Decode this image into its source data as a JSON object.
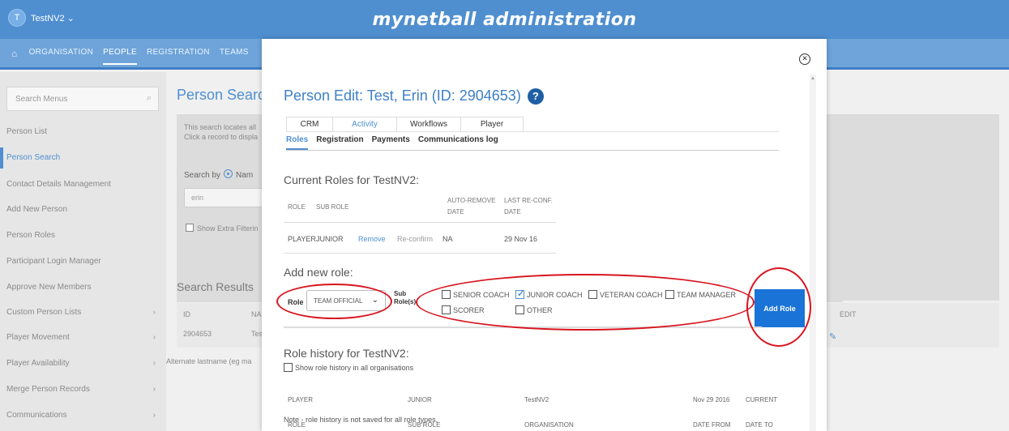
{
  "header": {
    "user_initial": "T",
    "user_name": "TestNV2 ⌄",
    "app_title": "mynetball administration"
  },
  "nav": {
    "home_icon": "home-icon",
    "items": [
      "ORGANISATION",
      "PEOPLE",
      "REGISTRATION",
      "TEAMS"
    ]
  },
  "sidebar": {
    "search_placeholder": "Search Menus",
    "items": [
      {
        "label": "Person List",
        "chevron": false
      },
      {
        "label": "Person Search",
        "chevron": false,
        "active": true
      },
      {
        "label": "Contact Details Management",
        "chevron": false
      },
      {
        "label": "Add New Person",
        "chevron": false
      },
      {
        "label": "Person Roles",
        "chevron": false
      },
      {
        "label": "Participant Login Manager",
        "chevron": false
      },
      {
        "label": "Approve New Members",
        "chevron": false
      },
      {
        "label": "Custom Person Lists",
        "chevron": true
      },
      {
        "label": "Player Movement",
        "chevron": true
      },
      {
        "label": "Player Availability",
        "chevron": true
      },
      {
        "label": "Merge Person Records",
        "chevron": true
      },
      {
        "label": "Communications",
        "chevron": true
      }
    ]
  },
  "background": {
    "title": "Person Search",
    "desc_line1": "This search locates all",
    "desc_line2": "Click a record to displa",
    "search_by": "Search by",
    "search_by_option": "Nam",
    "search_value": "erin",
    "extra_filter": "Show Extra Filterin",
    "results_title": "Search Results",
    "col_id": "ID",
    "col_name": "NAI",
    "col_edit": "EDIT",
    "row_id": "2904653",
    "row_name": "Test",
    "alt_note": "Alternate lastname (eg ma"
  },
  "modal": {
    "title": "Person Edit: Test, Erin (ID: 2904653)",
    "tabs_top": [
      "CRM",
      "Activity",
      "Workflows",
      "Player"
    ],
    "tabs_top_active": "Activity",
    "tabs_sub": [
      "Roles",
      "Registration",
      "Payments",
      "Communications log"
    ],
    "tabs_sub_active": "Roles",
    "current_roles_title": "Current Roles for TestNV2:",
    "current_roles": {
      "headers": {
        "role": "ROLE",
        "sub_role": "SUB ROLE",
        "auto_remove_1": "AUTO-REMOVE",
        "auto_remove_2": "DATE",
        "last_reconf_1": "LAST RE-CONF.",
        "last_reconf_2": "DATE"
      },
      "row": {
        "role": "PLAYER",
        "sub_role": "JUNIOR",
        "remove": "Remove",
        "reconfirm": "Re-confirm",
        "auto_remove": "NA",
        "last_reconf": "29 Nov 16"
      }
    },
    "add_role_title": "Add new role:",
    "role_label": "Role",
    "role_value": "TEAM OFFICIAL",
    "sub_role_label": "Sub Role(s)",
    "sub_roles": [
      {
        "label": "SENIOR COACH",
        "checked": false
      },
      {
        "label": "JUNIOR COACH",
        "checked": true
      },
      {
        "label": "VETERAN COACH",
        "checked": false
      },
      {
        "label": "TEAM MANAGER",
        "checked": false
      },
      {
        "label": "SCORER",
        "checked": false
      },
      {
        "label": "OTHER",
        "checked": false
      }
    ],
    "add_role_button": "Add Role",
    "history_title": "Role history for TestNV2:",
    "show_history_label": "Show role history in all organisations",
    "history_headers": {
      "role": "ROLE",
      "sub_role": "SUB ROLE",
      "organisation": "ORGANISATION",
      "date_from": "DATE FROM",
      "date_to": "DATE TO"
    },
    "history_row": {
      "role": "PLAYER",
      "sub_role": "JUNIOR",
      "organisation": "TestNV2",
      "date_from": "Nov 29 2016",
      "date_to": "CURRENT"
    },
    "history_note": "Note - role history is not saved for all role types."
  },
  "colors": {
    "header": "#4f8fd0",
    "accent": "#3e7fc5",
    "button": "#1a73d6",
    "annotation": "#d8141e"
  }
}
